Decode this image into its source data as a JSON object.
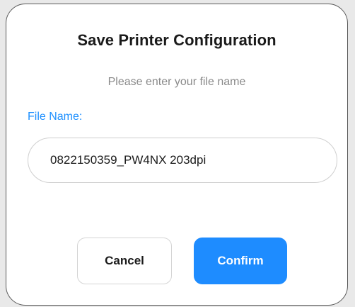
{
  "dialog": {
    "title": "Save Printer Configuration",
    "subtitle": "Please enter your file name",
    "field_label": "File Name:",
    "file_name_value": "0822150359_PW4NX 203dpi",
    "cancel_label": "Cancel",
    "confirm_label": "Confirm"
  },
  "colors": {
    "accent": "#1e8cff",
    "label_blue": "#1e90ff",
    "subtitle_gray": "#8a8a8a"
  }
}
